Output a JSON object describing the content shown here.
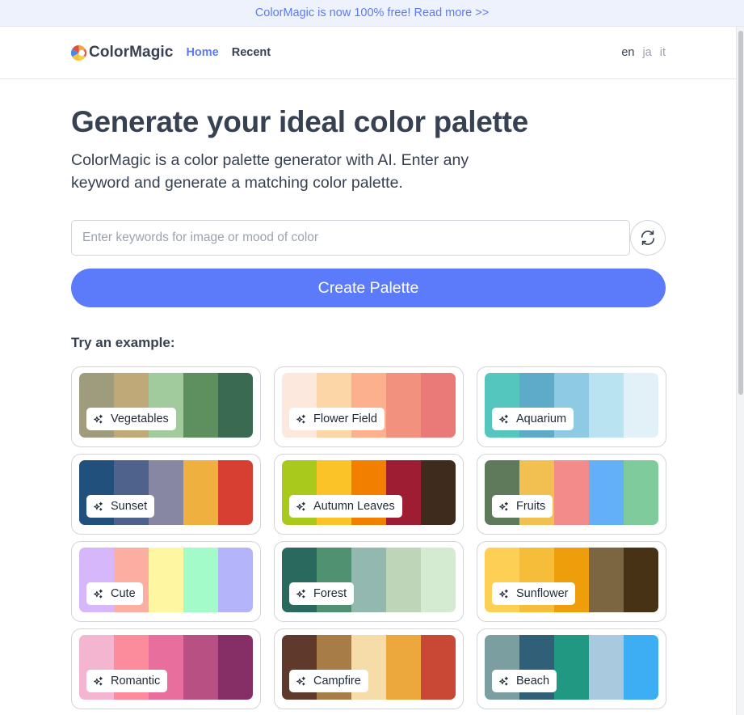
{
  "banner": {
    "text": "ColorMagic is now 100% free! Read more >>"
  },
  "header": {
    "logo_text": "ColorMagic",
    "nav": [
      {
        "label": "Home",
        "active": true
      },
      {
        "label": "Recent",
        "active": false
      }
    ],
    "languages": [
      "en",
      "ja",
      "it"
    ],
    "current_language": "en"
  },
  "hero": {
    "title": "Generate your ideal color palette",
    "subtitle": "ColorMagic is a color palette generator with AI. Enter any keyword and generate a matching color palette."
  },
  "search": {
    "placeholder": "Enter keywords for image or mood of color",
    "value": "",
    "refresh_icon": "refresh-icon"
  },
  "create_button": {
    "label": "Create Palette",
    "color": "#5b7bfa"
  },
  "examples": {
    "heading": "Try an example:",
    "icon": "sparkle-icon",
    "items": [
      {
        "label": "Vegetables",
        "colors": [
          "#9e9c7c",
          "#c0a978",
          "#a2cb9d",
          "#5d8f5f",
          "#3b6a52"
        ]
      },
      {
        "label": "Flower Field",
        "colors": [
          "#fde8de",
          "#fdd6a8",
          "#fcb08d",
          "#f2917e",
          "#ea7a77"
        ]
      },
      {
        "label": "Aquarium",
        "colors": [
          "#55c6bd",
          "#5dabc9",
          "#8ecae4",
          "#bae3f2",
          "#e2f1f8"
        ]
      },
      {
        "label": "Sunset",
        "colors": [
          "#21507d",
          "#4f628c",
          "#8787a3",
          "#f0b040",
          "#d63f31"
        ]
      },
      {
        "label": "Autumn Leaves",
        "colors": [
          "#a9ca1c",
          "#fbc327",
          "#f37f00",
          "#9f1d32",
          "#3e2b1e"
        ]
      },
      {
        "label": "Fruits",
        "colors": [
          "#5e7a5b",
          "#f2c050",
          "#f28b89",
          "#64b0f8",
          "#7fcb9b"
        ]
      },
      {
        "label": "Cute",
        "colors": [
          "#d6b7fb",
          "#fdaea3",
          "#fef6a0",
          "#a3fbca",
          "#b4b4fb"
        ]
      },
      {
        "label": "Forest",
        "colors": [
          "#2a6a5e",
          "#4f9170",
          "#93b8b0",
          "#bfd5b8",
          "#d5ebd1"
        ]
      },
      {
        "label": "Sunflower",
        "colors": [
          "#fdd055",
          "#f6bd3b",
          "#ef9e0b",
          "#7c6541",
          "#473216"
        ]
      },
      {
        "label": "Romantic",
        "colors": [
          "#f4b5d0",
          "#fc8b9b",
          "#e76e9d",
          "#b85083",
          "#862e66"
        ]
      },
      {
        "label": "Campfire",
        "colors": [
          "#5f392c",
          "#a87c46",
          "#f5dca9",
          "#eca83c",
          "#c94835"
        ]
      },
      {
        "label": "Beach",
        "colors": [
          "#7b9fa1",
          "#2f6078",
          "#219882",
          "#a9c9de",
          "#3eaef4"
        ]
      }
    ]
  }
}
